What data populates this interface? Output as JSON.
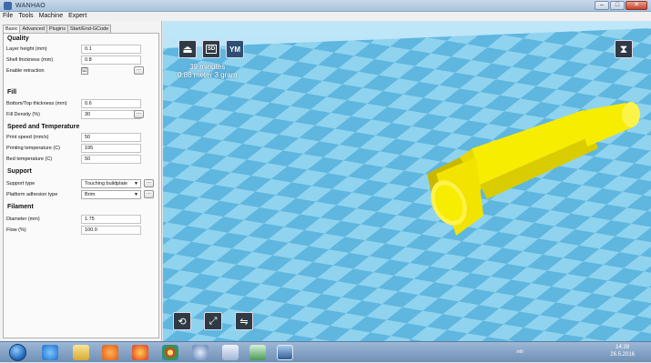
{
  "window": {
    "title": "WANHAO",
    "min_glyph": "–",
    "max_glyph": "□",
    "close_glyph": "✕"
  },
  "menu": [
    "File",
    "Tools",
    "Machine",
    "Expert"
  ],
  "tabs": [
    "Basic",
    "Advanced",
    "Plugins",
    "Start/End-GCode"
  ],
  "quality": {
    "title": "Quality",
    "layer_height_label": "Layer height (mm)",
    "layer_height": "0.1",
    "shell_label": "Shell thickness (mm)",
    "shell": "0.8",
    "retraction_label": "Enable retraction",
    "retraction_mark": "☑"
  },
  "fill": {
    "title": "Fill",
    "bottom_top_label": "Bottom/Top thickness (mm)",
    "bottom_top": "0.6",
    "density_label": "Fill Density (%)",
    "density": "30"
  },
  "speed": {
    "title": "Speed and Temperature",
    "print_speed_label": "Print speed (mm/s)",
    "print_speed": "50",
    "print_temp_label": "Printing temperature (C)",
    "print_temp": "195",
    "bed_temp_label": "Bed temperature (C)",
    "bed_temp": "50"
  },
  "support": {
    "title": "Support",
    "type_label": "Support type",
    "type": "Touching buildplate",
    "adhesion_label": "Platform adhesion type",
    "adhesion": "Brim"
  },
  "filament": {
    "title": "Filament",
    "diameter_label": "Diameter (mm)",
    "diameter": "1.75",
    "flow_label": "Flow (%)",
    "flow": "100.0"
  },
  "buttons": {
    "dots": "...",
    "sd_label": "SD",
    "ym_label": "YM"
  },
  "print_info": {
    "time": "39 minutes",
    "material": "0.86 meter 3 gram"
  },
  "taskbar": {
    "lang": "nth",
    "clock_time": "14:28",
    "clock_date": "26.5.2016"
  },
  "colors": {
    "floor_light": "#8fd3ef",
    "floor_dark": "#5fb6df",
    "model": "#f7ed00",
    "model_shade": "#c9b800",
    "toolbar_icon": "#2f3a44"
  }
}
